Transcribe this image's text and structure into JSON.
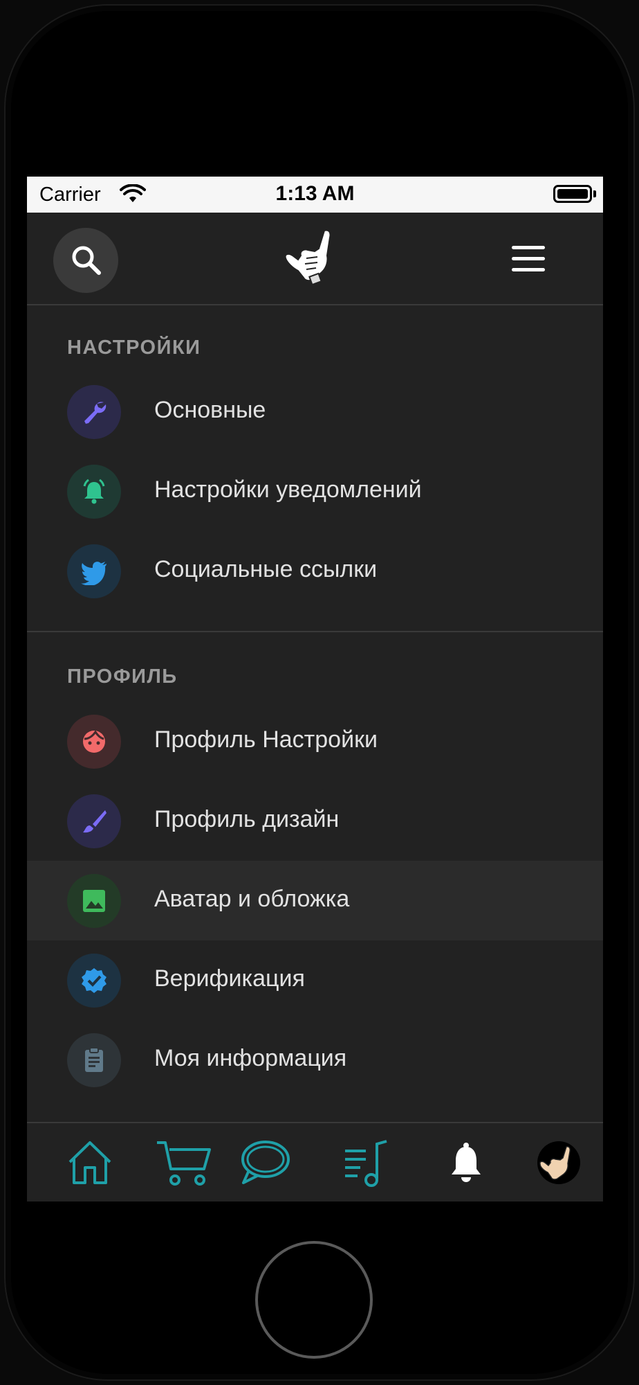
{
  "status_bar": {
    "carrier": "Carrier",
    "time": "1:13 AM"
  },
  "header": {
    "search_icon": "search-icon",
    "logo_icon": "shaka-hand-logo",
    "menu_icon": "hamburger-menu-icon"
  },
  "sections": [
    {
      "title": "НАСТРОЙКИ",
      "items": [
        {
          "label": "Основные",
          "icon": "wrench-icon",
          "color": "#7b6cf6"
        },
        {
          "label": "Настройки уведомлений",
          "icon": "bell-ringing-icon",
          "color": "#2fc38f"
        },
        {
          "label": "Социальные ссылки",
          "icon": "twitter-icon",
          "color": "#2f9ae8"
        }
      ]
    },
    {
      "title": "ПРОФИЛЬ",
      "items": [
        {
          "label": "Профиль Настройки",
          "icon": "face-icon",
          "color": "#f26a6a"
        },
        {
          "label": "Профиль дизайн",
          "icon": "brush-icon",
          "color": "#7b6cf6"
        },
        {
          "label": "Аватар и обложка",
          "icon": "image-icon",
          "color": "#3fba5c",
          "active": true
        },
        {
          "label": "Верификация",
          "icon": "verified-badge-icon",
          "color": "#2f9ae8"
        },
        {
          "label": "Моя информация",
          "icon": "clipboard-icon",
          "color": "#607a8a"
        }
      ]
    }
  ],
  "tab_bar": {
    "items": [
      {
        "icon": "home-icon",
        "color": "#1fa0a8"
      },
      {
        "icon": "cart-icon",
        "color": "#1fa0a8"
      },
      {
        "icon": "chat-bubble-icon",
        "color": "#1fa0a8"
      },
      {
        "icon": "playlist-icon",
        "color": "#1fa0a8"
      },
      {
        "icon": "bell-icon",
        "color": "#ffffff"
      },
      {
        "icon": "avatar-icon",
        "color": "#000000"
      }
    ]
  }
}
